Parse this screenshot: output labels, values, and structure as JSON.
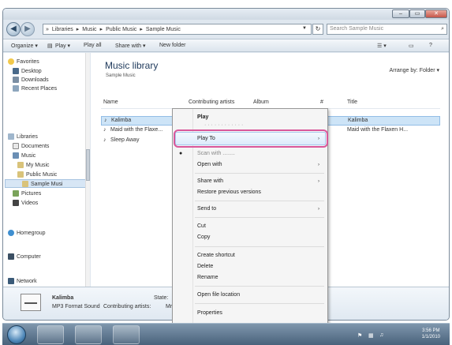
{
  "window": {
    "controls": [
      "–",
      "▭",
      "✕"
    ]
  },
  "address": {
    "crumbs": [
      "»",
      "Libraries",
      "▸",
      "Music",
      "▸",
      "Public Music",
      "▸",
      "Sample Music"
    ],
    "refresh_icon": "↻",
    "search_placeholder": "Search Sample Music"
  },
  "toolbar": {
    "organize": "Organize ▾",
    "play": "Play ▾",
    "play_all": "Play all",
    "share_with": "Share with ▾",
    "new_folder": "New folder",
    "views_icon": "☰ ▾"
  },
  "nav": {
    "favorites": "Favorites",
    "desktop": "Desktop",
    "downloads": "Downloads",
    "recent": "Recent Places",
    "libraries": "Libraries",
    "documents": "Documents",
    "music": "Music",
    "my_music": "My Music",
    "public_music": "Public Music",
    "sample_music": "Sample Musi",
    "pictures": "Pictures",
    "videos": "Videos",
    "homegroup": "Homegroup",
    "computer": "Computer",
    "network": "Network"
  },
  "content": {
    "title": "Music library",
    "subtitle": "Sample Music",
    "arrange_label": "Arrange by:",
    "arrange_value": "Folder ▾",
    "columns": {
      "name": "Name",
      "artists": "Contributing artists",
      "album": "Album",
      "num": "#",
      "title": "Title"
    },
    "files": [
      {
        "name": "Kalimba",
        "title": "Kalimba"
      },
      {
        "name": "Maid with the Flaxe...",
        "title": "Maid with the Flaxen H..."
      },
      {
        "name": "Sleep Away",
        "title": ""
      }
    ]
  },
  "details": {
    "name": "Kalimba",
    "type": "MP3 Format Sound",
    "artists_label": "Contributing artists:",
    "artists_value": "Mr",
    "state_label": "State:"
  },
  "menu": {
    "play": "Play",
    "play_to": "Play To",
    "hidden_item": "Scan with ........",
    "open_with": "Open with",
    "share_with": "Share with",
    "restore": "Restore previous versions",
    "send_to": "Send to",
    "cut": "Cut",
    "copy": "Copy",
    "create_shortcut": "Create shortcut",
    "delete": "Delete",
    "rename": "Rename",
    "open_location": "Open file location",
    "properties": "Properties",
    "arrow": "›"
  },
  "taskbar": {
    "time": "3:56 PM",
    "date": "1/1/2010"
  },
  "colors": {
    "highlight_ring": "#d9589a",
    "selection": "#cde4f7"
  }
}
